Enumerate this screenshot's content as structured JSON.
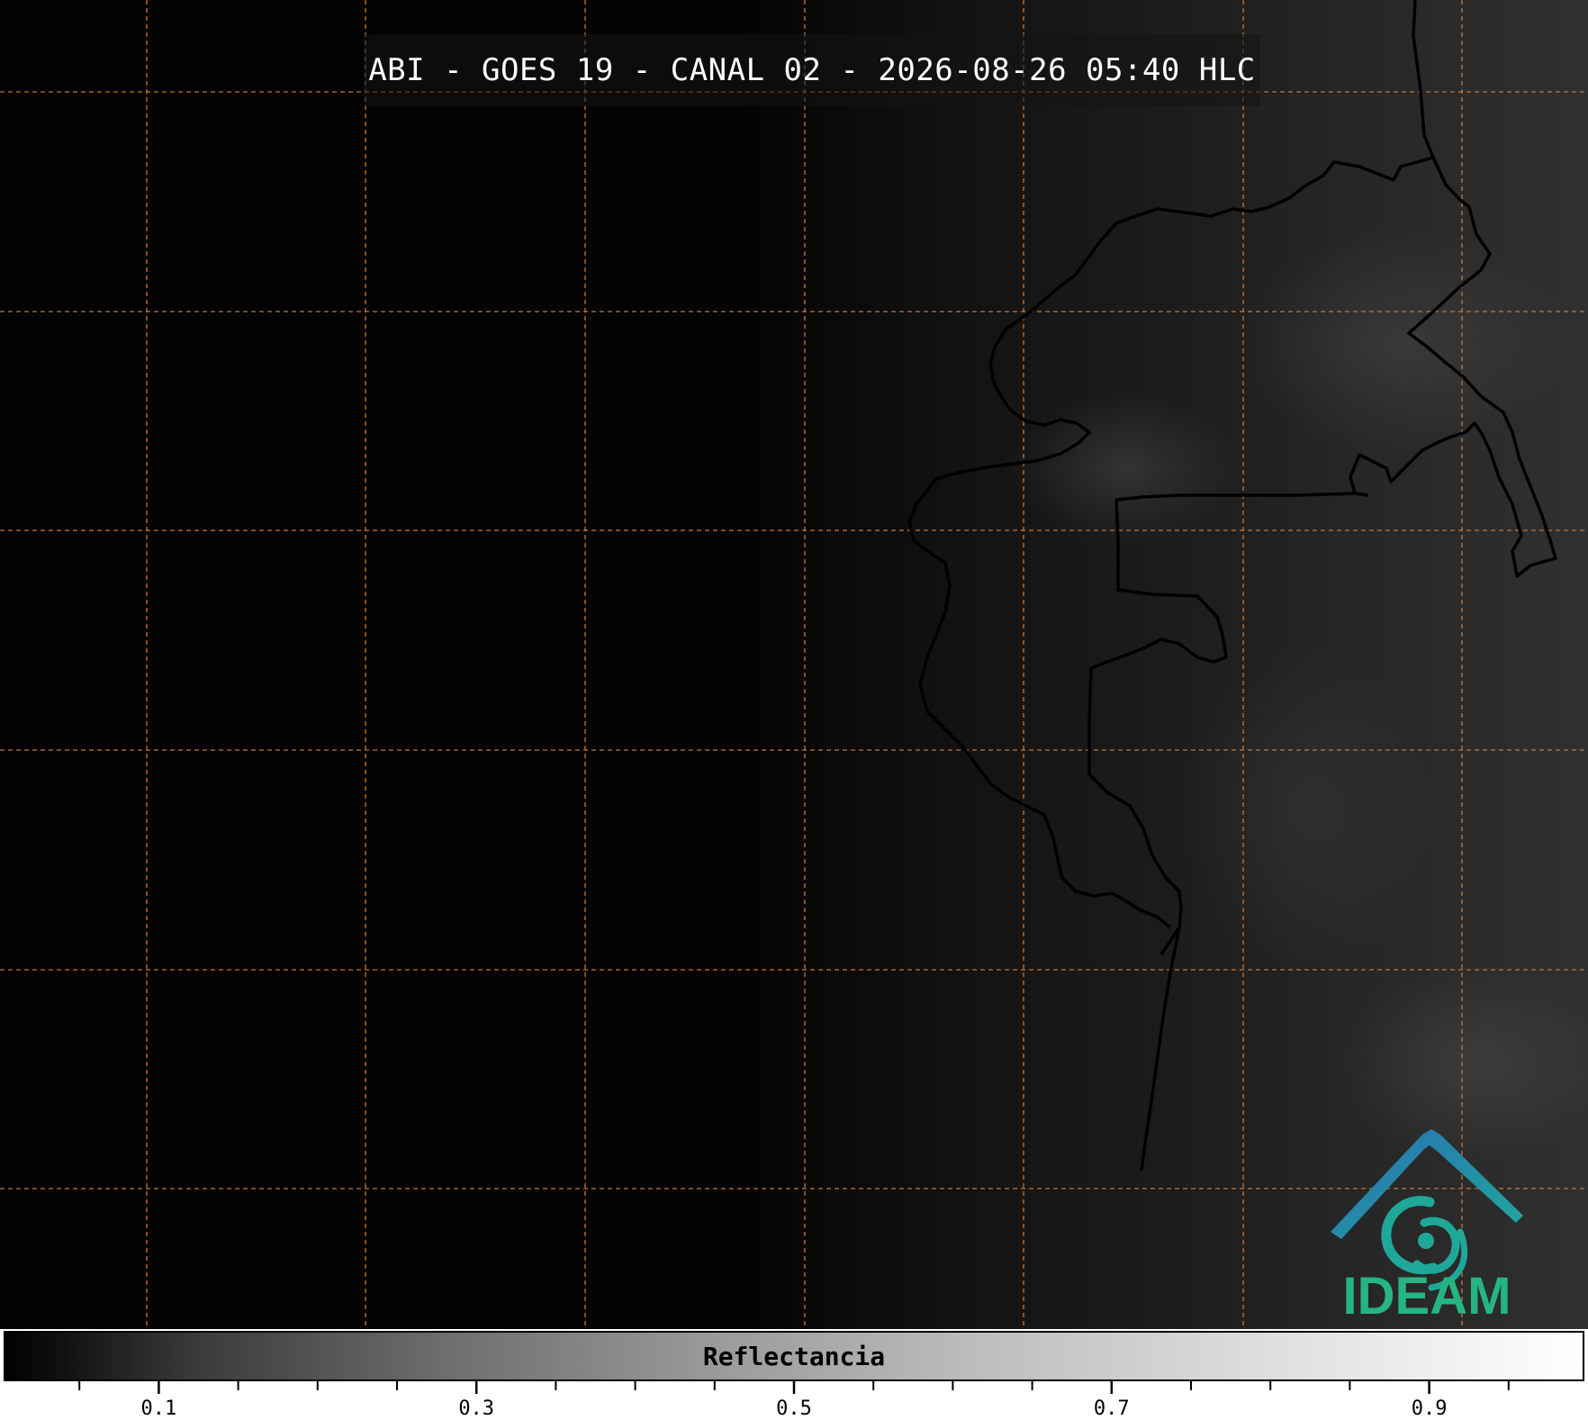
{
  "title": "ABI - GOES 19 - CANAL 02 - 2026-08-26 05:40 HLC",
  "logo": {
    "text": "IDEAM",
    "colors": {
      "roof": "#2a6fb5",
      "swirl": "#1fa89a",
      "text": "#25b583"
    }
  },
  "colors": {
    "gridline": "#c87533",
    "border": "#000000"
  },
  "colorbar": {
    "label": "Reflectancia",
    "range": [
      0,
      1
    ],
    "major_ticks": [
      {
        "value": 0.1,
        "label": "0.1"
      },
      {
        "value": 0.3,
        "label": "0.3"
      },
      {
        "value": 0.5,
        "label": "0.5"
      },
      {
        "value": 0.7,
        "label": "0.7"
      },
      {
        "value": 0.9,
        "label": "0.9"
      }
    ],
    "minor_ticks": [
      0.05,
      0.15,
      0.2,
      0.25,
      0.35,
      0.4,
      0.45,
      0.55,
      0.6,
      0.65,
      0.75,
      0.8,
      0.85,
      0.95
    ],
    "colormap": "grayscale"
  }
}
